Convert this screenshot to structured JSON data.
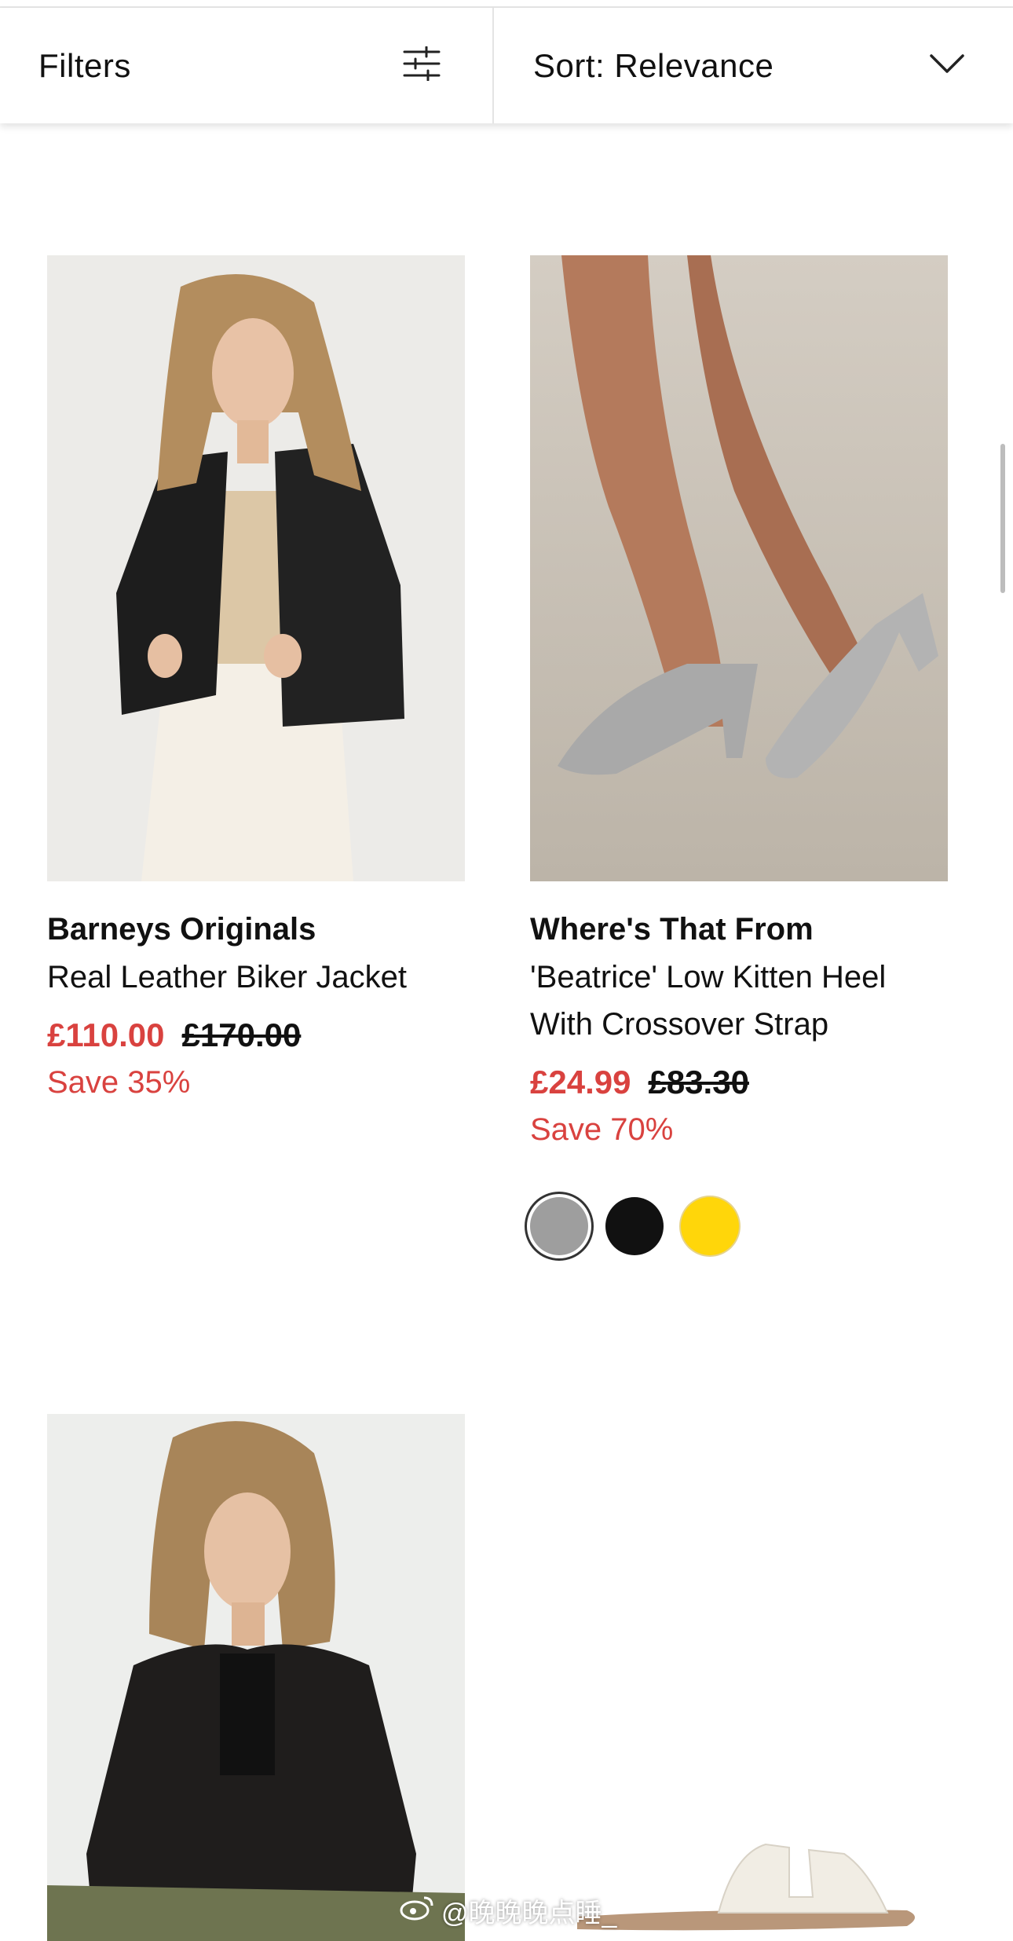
{
  "toolbar": {
    "filters_label": "Filters",
    "filters_icon": "sliders-icon",
    "sort_label": "Sort: Relevance",
    "sort_icon": "chevron-down-icon"
  },
  "products": [
    {
      "brand": "Barneys Originals",
      "title": "Real Leather Biker Jacket",
      "price_now": "£110.00",
      "price_was": "£170.00",
      "save": "Save 35%"
    },
    {
      "brand": "Where's That From",
      "title": "'Beatrice' Low Kitten Heel With Crossover Strap",
      "price_now": "£24.99",
      "price_was": "£83.30",
      "save": "Save 70%",
      "swatches": [
        {
          "name": "silver",
          "color": "#9e9e9e",
          "selected": true
        },
        {
          "name": "black",
          "color": "#111111",
          "selected": false
        },
        {
          "name": "yellow",
          "color": "#ffd60a",
          "selected": false
        }
      ]
    }
  ],
  "watermark": "@晚晚晚点睡_",
  "colors": {
    "sale_red": "#d9423f",
    "divider": "#e4e4e4"
  }
}
